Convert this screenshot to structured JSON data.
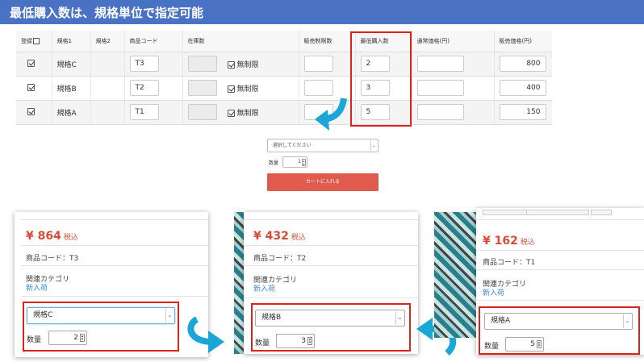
{
  "title": "最低購入数は、規格単位で指定可能",
  "table": {
    "headers": {
      "register": "登録",
      "spec1": "規格1",
      "spec2": "規格2",
      "product_code": "商品コード",
      "stock": "在庫数",
      "sale_limit": "販売制限数",
      "min_purchase": "最低購入数",
      "normal_price": "通常価格(円)",
      "sale_price": "販売価格(円)"
    },
    "unlimited_label": "無制限",
    "rows": [
      {
        "spec1": "規格C",
        "spec2": "",
        "code": "T3",
        "stock": "",
        "limit": "",
        "min": "2",
        "normal": "",
        "price": "800"
      },
      {
        "spec1": "規格B",
        "spec2": "",
        "code": "T2",
        "stock": "",
        "limit": "",
        "min": "3",
        "normal": "",
        "price": "400"
      },
      {
        "spec1": "規格A",
        "spec2": "",
        "code": "T1",
        "stock": "",
        "limit": "",
        "min": "5",
        "normal": "",
        "price": "150"
      }
    ]
  },
  "mid_form": {
    "select_placeholder": "選択してください",
    "qty_label": "数量",
    "qty_value": "1",
    "cart_button": "カートに入れる"
  },
  "panels": [
    {
      "price": "¥ 864",
      "tax": "税込",
      "code_label": "商品コード：",
      "code": "T3",
      "category_label": "関連カテゴリ",
      "category": "新入荷",
      "selected": "規格C",
      "qty_label": "数量",
      "qty": "2"
    },
    {
      "price": "¥ 432",
      "tax": "税込",
      "code_label": "商品コード：",
      "code": "T2",
      "category_label": "関連カテゴリ",
      "category": "新入荷",
      "selected": "規格B",
      "qty_label": "数量",
      "qty": "3"
    },
    {
      "price": "¥ 162",
      "tax": "税込",
      "code_label": "商品コード：",
      "code": "T1",
      "category_label": "関連カテゴリ",
      "category": "新入荷",
      "selected": "規格A",
      "qty_label": "数量",
      "qty": "5"
    }
  ],
  "colors": {
    "title_bar": "#4a72c4",
    "highlight": "#e0201a",
    "arrow": "#1aa7d8",
    "price": "#d94a3a",
    "cart_button": "#e05a4e",
    "link": "#3a8ad0"
  },
  "icons": {
    "checkbox": "checkbox-checked-icon",
    "select": "chevron-down-icon",
    "stepper": "spin-stepper-icon",
    "arrow": "curved-arrow-icon"
  }
}
